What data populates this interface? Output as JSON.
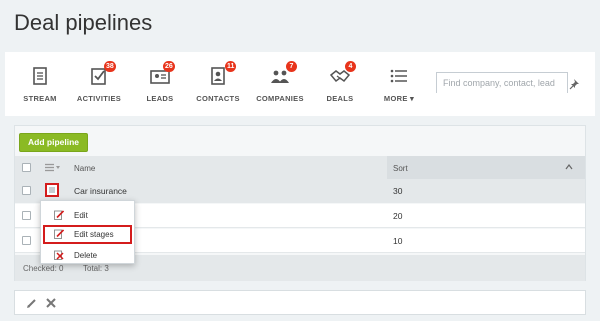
{
  "page": {
    "title": "Deal pipelines"
  },
  "nav": {
    "items": [
      {
        "key": "stream",
        "label": "STREAM",
        "badge": ""
      },
      {
        "key": "activities",
        "label": "ACTIVITIES",
        "badge": "38"
      },
      {
        "key": "leads",
        "label": "LEADS",
        "badge": "26"
      },
      {
        "key": "contacts",
        "label": "CONTACTS",
        "badge": "11"
      },
      {
        "key": "companies",
        "label": "COMPANIES",
        "badge": "7"
      },
      {
        "key": "deals",
        "label": "DEALS",
        "badge": "4"
      },
      {
        "key": "more",
        "label": "MORE ▾",
        "badge": ""
      }
    ]
  },
  "search": {
    "placeholder": "Find company, contact, lead"
  },
  "actions": {
    "add_pipeline": "Add pipeline"
  },
  "table": {
    "columns": {
      "name": "Name",
      "sort": "Sort"
    },
    "rows": [
      {
        "name": "Car insurance",
        "sort": "30"
      },
      {
        "name": "",
        "sort": "20"
      },
      {
        "name": "",
        "sort": "10"
      }
    ]
  },
  "footer": {
    "checked": "Checked: 0",
    "total": "Total: 3"
  },
  "context_menu": {
    "items": [
      {
        "label": "Edit",
        "icon": "edit-icon"
      },
      {
        "label": "Edit stages",
        "icon": "edit-stages-icon"
      },
      {
        "label": "Delete",
        "icon": "delete-icon"
      }
    ]
  },
  "colors": {
    "accent_green": "#8bba24",
    "badge_red": "#e8341b",
    "highlight_red": "#d41c1c"
  }
}
